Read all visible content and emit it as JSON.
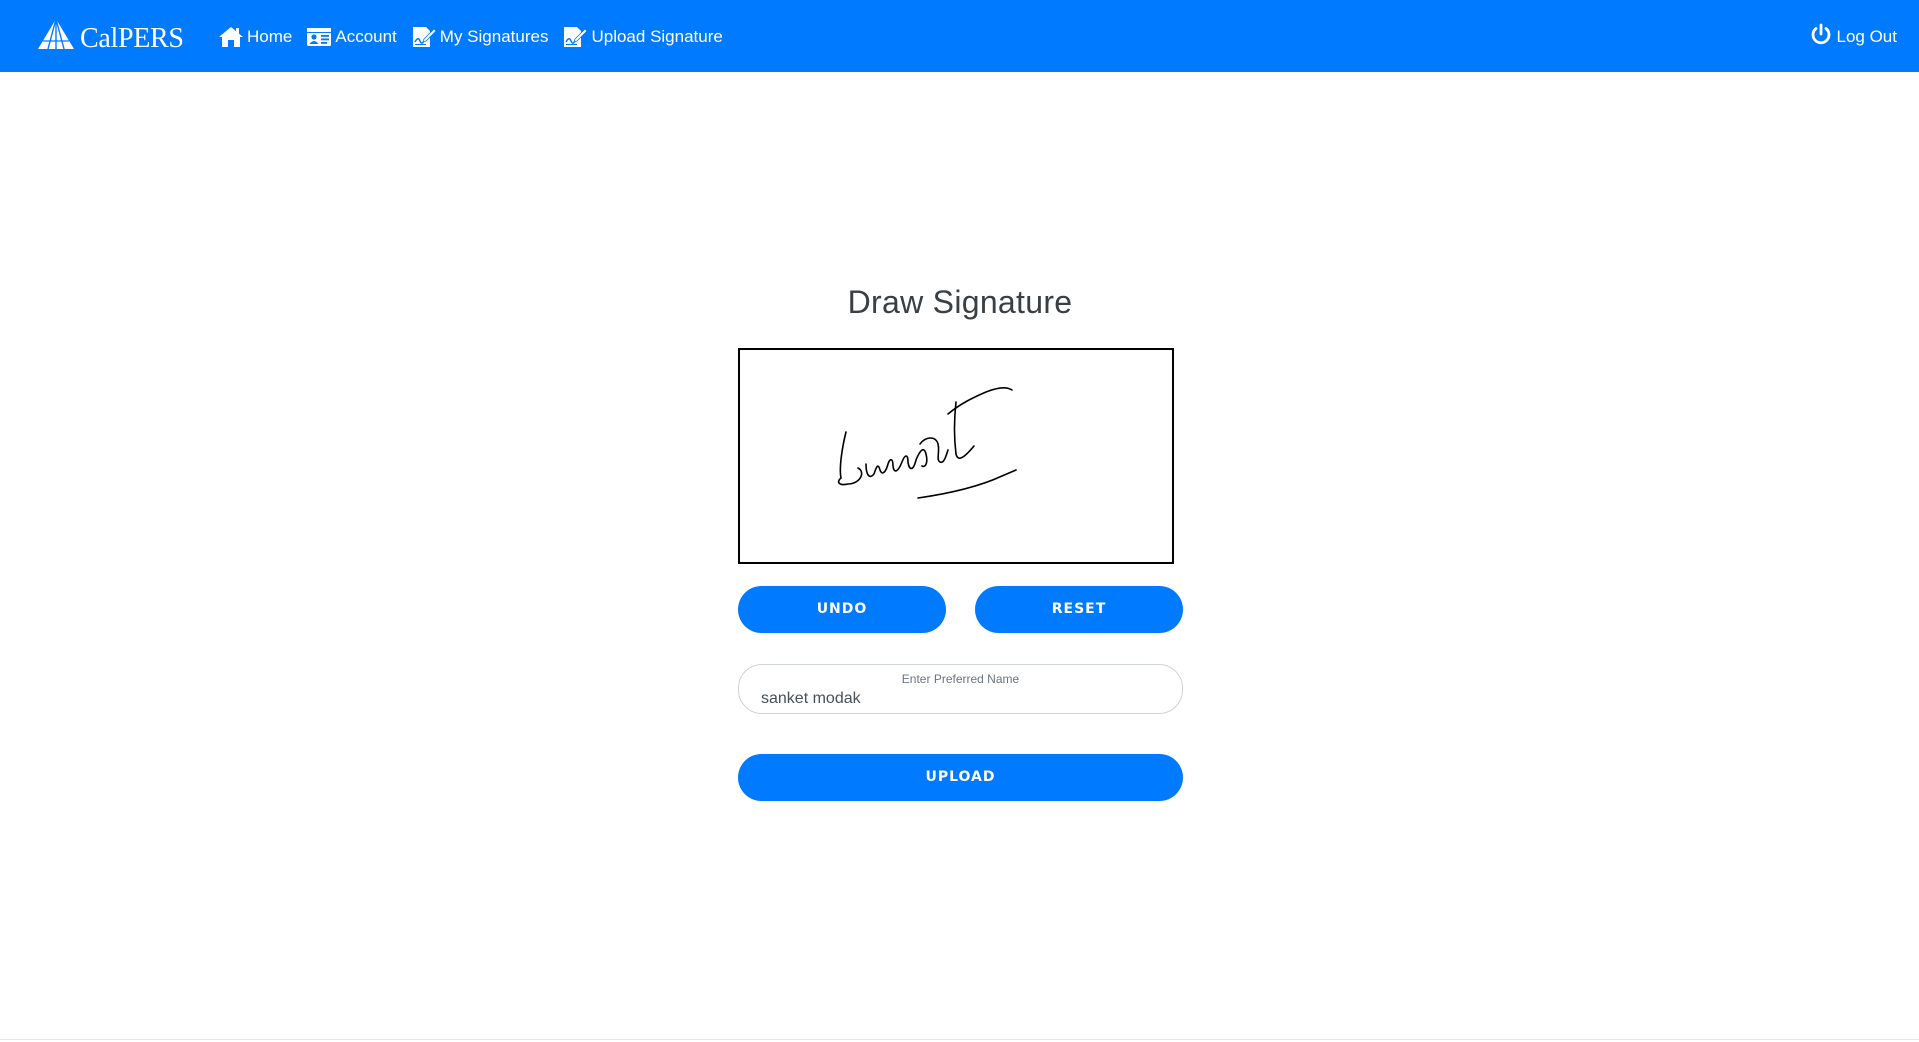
{
  "header": {
    "brand": "CalPERS",
    "nav": [
      {
        "label": "Home",
        "icon": "home-icon"
      },
      {
        "label": "Account",
        "icon": "id-card-icon"
      },
      {
        "label": "My Signatures",
        "icon": "signature-icon"
      },
      {
        "label": "Upload Signature",
        "icon": "upload-signature-icon"
      }
    ],
    "logout": {
      "label": "Log Out",
      "icon": "power-icon"
    }
  },
  "main": {
    "title": "Draw Signature",
    "undo_label": "UNDO",
    "reset_label": "RESET",
    "name_label": "Enter Preferred Name",
    "name_value": "sanket modak",
    "upload_label": "UPLOAD"
  },
  "colors": {
    "primary": "#007bff",
    "text": "#3a3f44",
    "signature_ink": "#000000"
  }
}
